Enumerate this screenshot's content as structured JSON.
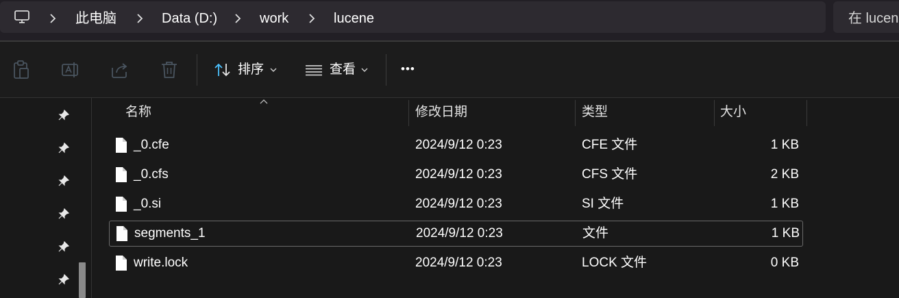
{
  "breadcrumb": {
    "items": [
      "此电脑",
      "Data (D:)",
      "work",
      "lucene"
    ]
  },
  "search": {
    "placeholder": "在 lucene"
  },
  "toolbar": {
    "sort_label": "排序",
    "view_label": "查看",
    "more_label": "•••"
  },
  "columns": {
    "name": "名称",
    "date": "修改日期",
    "type": "类型",
    "size": "大小"
  },
  "files": [
    {
      "name": "_0.cfe",
      "date": "2024/9/12 0:23",
      "type": "CFE 文件",
      "size": "1 KB"
    },
    {
      "name": "_0.cfs",
      "date": "2024/9/12 0:23",
      "type": "CFS 文件",
      "size": "2 KB"
    },
    {
      "name": "_0.si",
      "date": "2024/9/12 0:23",
      "type": "SI 文件",
      "size": "1 KB"
    },
    {
      "name": "segments_1",
      "date": "2024/9/12 0:23",
      "type": "文件",
      "size": "1 KB"
    },
    {
      "name": "write.lock",
      "date": "2024/9/12 0:23",
      "type": "LOCK 文件",
      "size": "0 KB"
    }
  ],
  "icons": {
    "pc": "computer-icon",
    "copy": "copy-icon",
    "rename": "rename-icon",
    "share": "share-icon",
    "delete": "trash-icon",
    "sort": "sort-icon",
    "view": "view-list-icon",
    "pin": "pin-icon",
    "file": "file-icon"
  },
  "colors": {
    "background": "#191919",
    "addressbar": "#2d2a30",
    "selection_border": "#6b6b6b",
    "sort_accent": "#4cc2ff"
  }
}
